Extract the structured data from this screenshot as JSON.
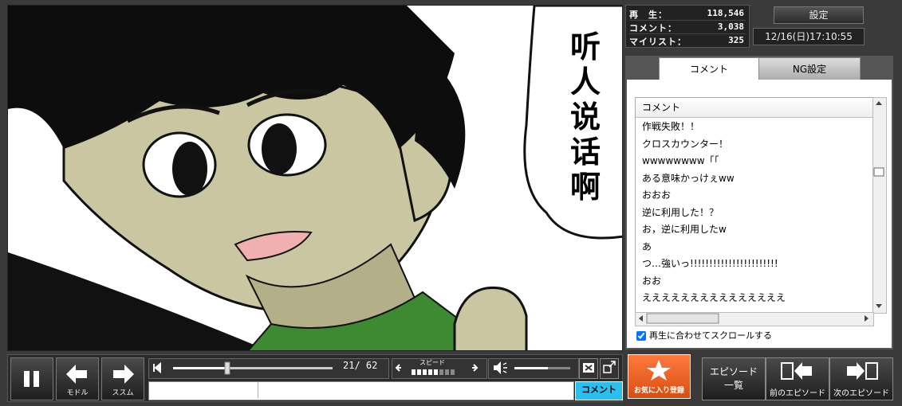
{
  "stats": {
    "play_label": "再　生：",
    "play_count": "118,546",
    "comment_label": "コメント：",
    "comment_count": "3,038",
    "mylist_label": "マイリスト：",
    "mylist_count": "325"
  },
  "settings_label": "設定",
  "datetime": "12/16(日)17:10:55",
  "video": {
    "bubble_text": "听人说话啊"
  },
  "panel": {
    "tabs": [
      {
        "label": "コメント",
        "active": true
      },
      {
        "label": "NG設定",
        "active": false
      }
    ],
    "list_header": "コメント",
    "comments": [
      "作戦失敗！！",
      "クロスカウンター！",
      "wwwwwwww「「",
      "ある意味かっけぇww",
      "おおお",
      "逆に利用した！？",
      "お，逆に利用したw",
      "あ",
      "つ…強いっ!!!!!!!!!!!!!!!!!!!!!!!",
      "おお",
      "えええええええええええええええ"
    ],
    "sync_label": "再生に合わせてスクロールする",
    "sync_checked": true
  },
  "controls": {
    "pause_icon": "pause-icon",
    "back_label": "モドル",
    "forward_label": "ススム",
    "time_display": "21/ 62",
    "progress": 0.34,
    "speed_label": "スピード",
    "volume_level": 0.6,
    "comment_submit_label": "コメント"
  },
  "buttons": {
    "favorite_label": "お気に入り登録",
    "episode_list_label_1": "エピソード",
    "episode_list_label_2": "一覧",
    "prev_episode_label": "前のエピソード",
    "next_episode_label": "次のエピソード"
  },
  "colors": {
    "accent_orange": "#e8621f",
    "comment_button_cyan": "#29c0f0",
    "skin": "#c9c6a1",
    "shirt_green": "#3d8a32"
  }
}
